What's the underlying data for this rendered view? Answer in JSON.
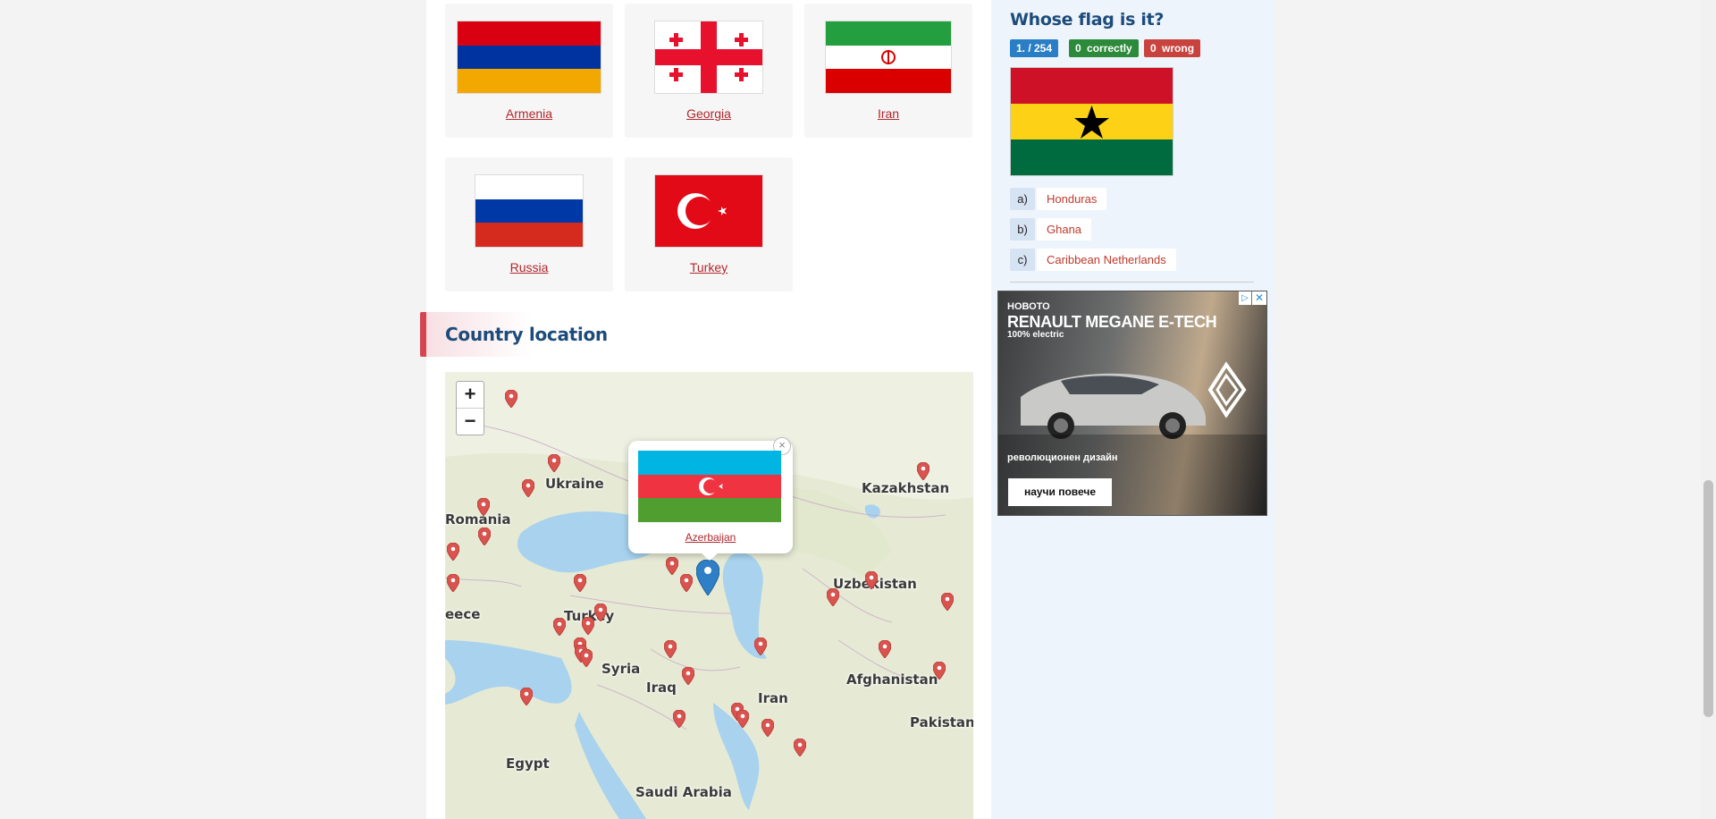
{
  "neighbours": [
    {
      "name": "Armenia"
    },
    {
      "name": "Georgia"
    },
    {
      "name": "Iran"
    },
    {
      "name": "Russia"
    },
    {
      "name": "Turkey"
    }
  ],
  "section": {
    "title": "Country location"
  },
  "map": {
    "zoom_in": "+",
    "zoom_out": "−",
    "labels": [
      "Ukraine",
      "Romania",
      "Kazakhstan",
      "Uzbekistan",
      "eece",
      "Turkey",
      "Syria",
      "Iraq",
      "Iran",
      "Afghanistan",
      "Pakistan",
      "Egypt",
      "Saudi Arabia"
    ],
    "popup": {
      "country": "Azerbaijan",
      "close": "×"
    }
  },
  "quiz": {
    "title": "Whose flag is it?",
    "progress": "1. / 254",
    "correct_count": "0",
    "correct_label": "correctly",
    "wrong_count": "0",
    "wrong_label": "wrong",
    "answers": [
      {
        "letter": "a)",
        "text": "Honduras"
      },
      {
        "letter": "b)",
        "text": "Ghana"
      },
      {
        "letter": "c)",
        "text": "Caribbean Netherlands"
      }
    ]
  },
  "ad": {
    "line1": "НОВОТО",
    "line2": "RENAULT MEGANE E-TECH",
    "line3": "100% electric",
    "tagline": "революционен дизайн",
    "button": "научи повече",
    "close": "✕",
    "info": "▷"
  },
  "colors": {
    "link": "#b0262d",
    "heading": "#1d4b7a",
    "accent": "#d6454f"
  }
}
